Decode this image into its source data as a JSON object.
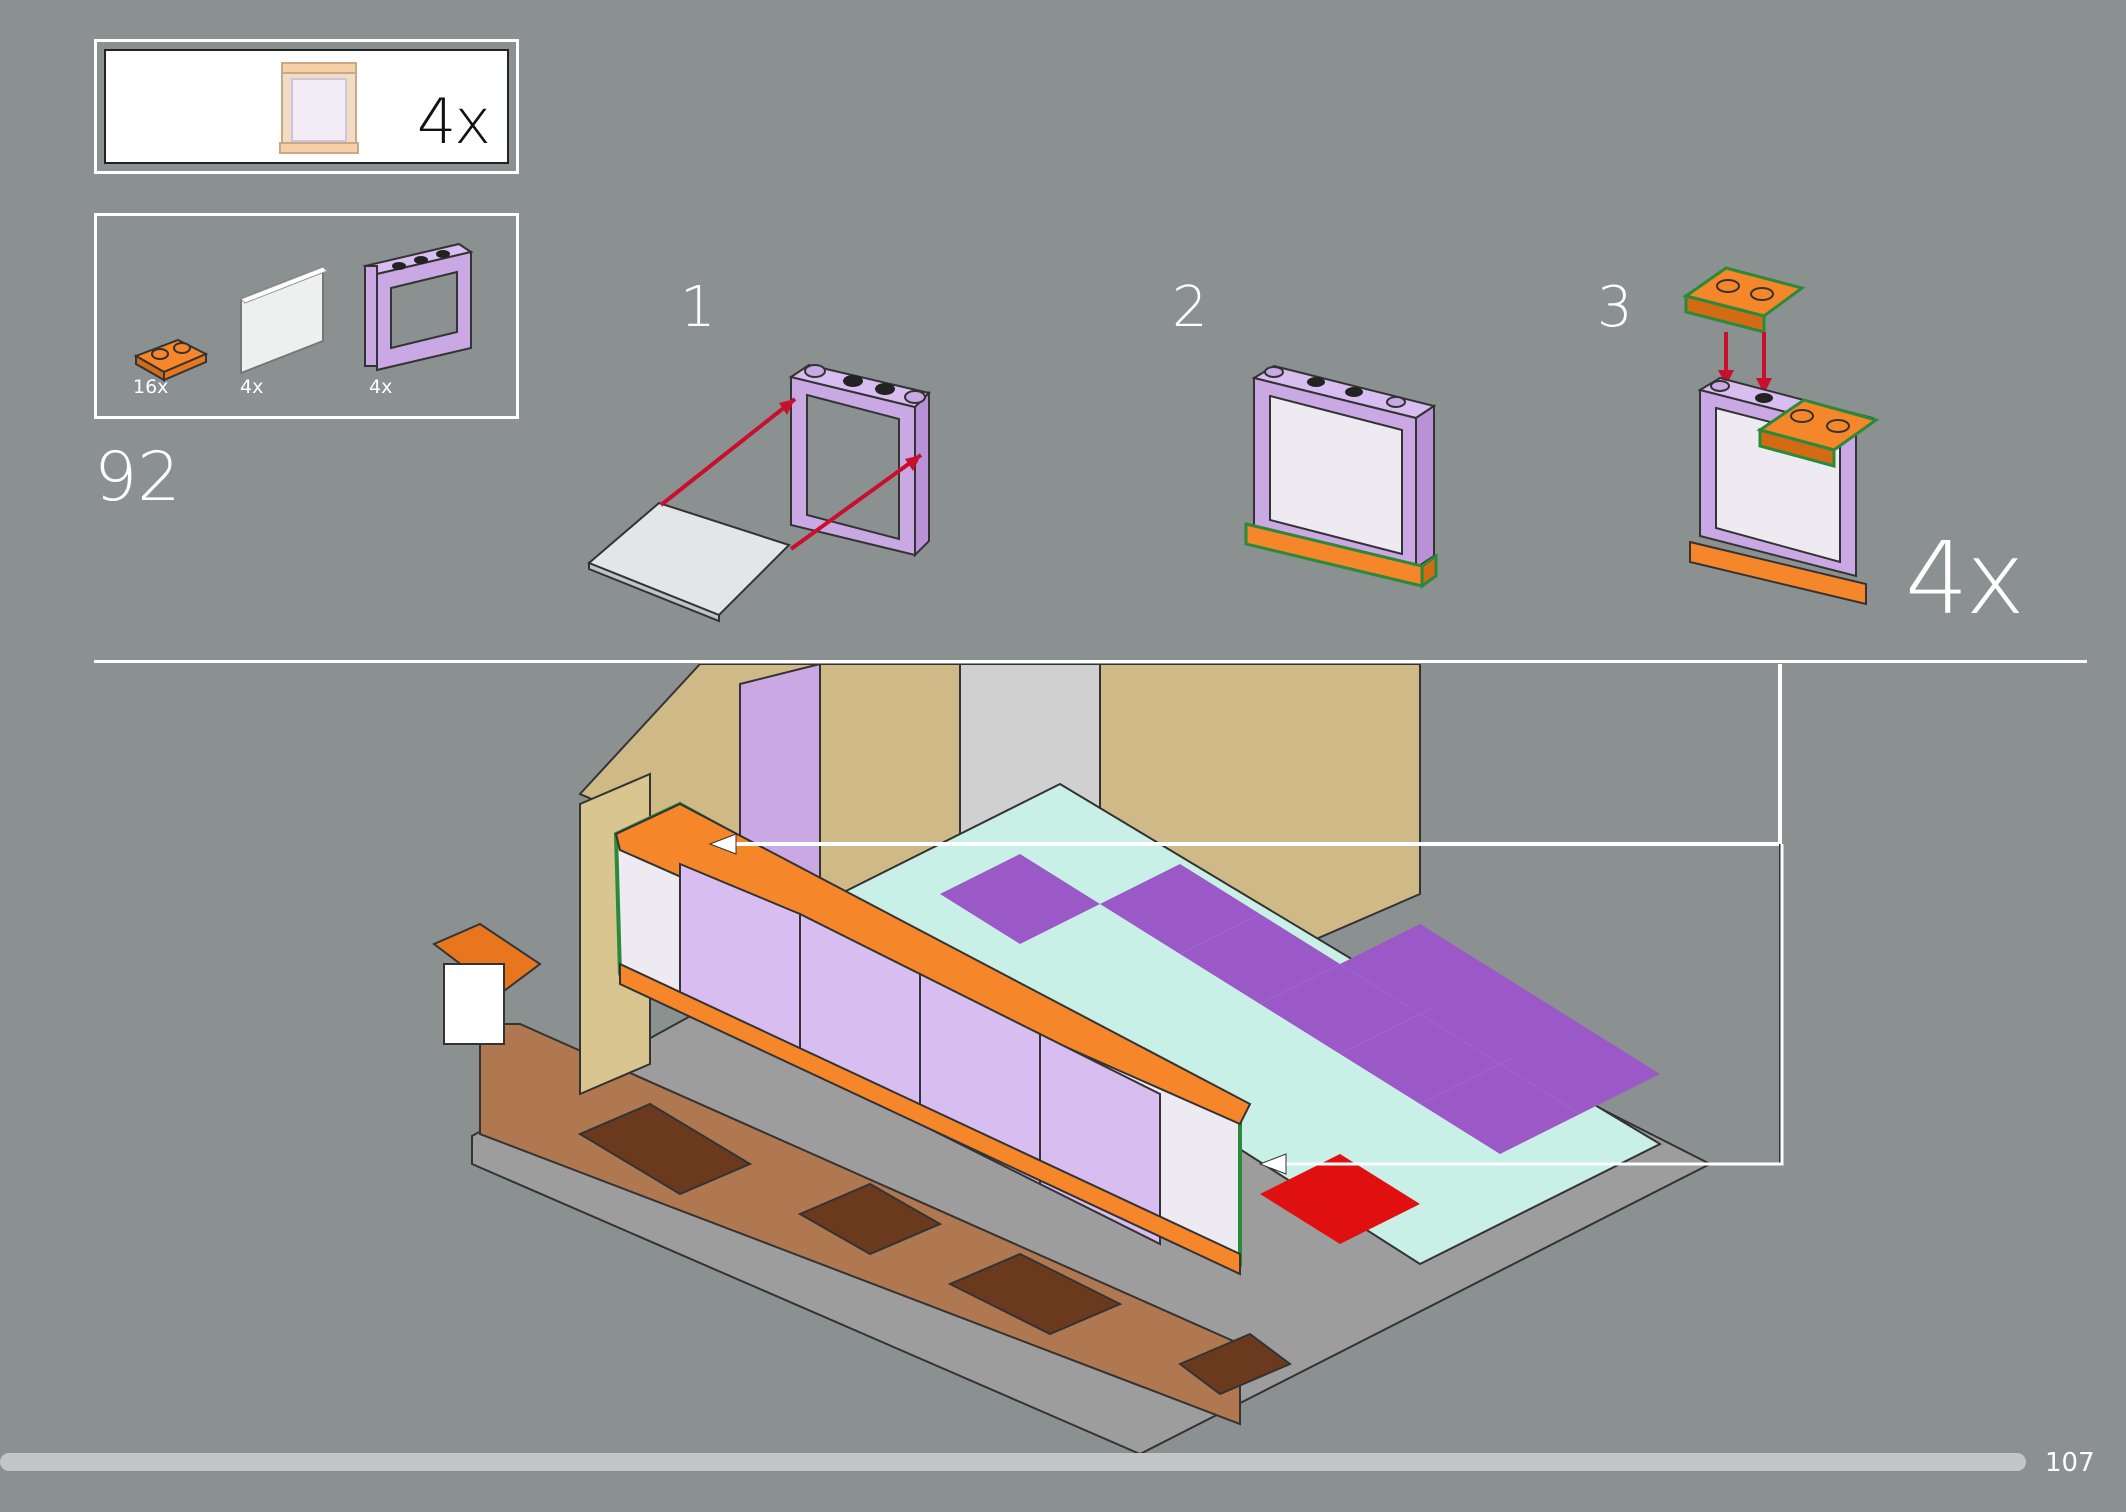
{
  "callout": {
    "multiplier": "4x"
  },
  "parts": [
    {
      "name": "orange 1x2 plate",
      "qty": "16x"
    },
    {
      "name": "transparent window glass",
      "qty": "4x"
    },
    {
      "name": "lavender window frame 1x4x3",
      "qty": "4x"
    }
  ],
  "step_number": "92",
  "substeps": [
    "1",
    "2",
    "3"
  ],
  "repeat_multiplier": "4x",
  "page_number": "107",
  "colors": {
    "background": "#8b9091",
    "lavender": "#c9a8e3",
    "orange": "#f5862a",
    "arrow_red": "#c8102e",
    "highlight_green": "#2a8a3a"
  }
}
